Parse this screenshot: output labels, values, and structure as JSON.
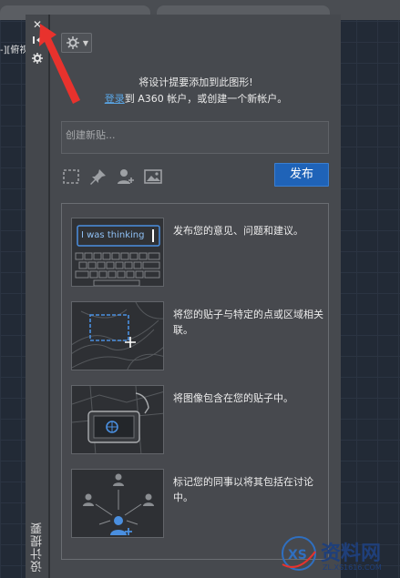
{
  "panel": {
    "title": "设计提要",
    "intro_line1": "将设计提要添加到此图形!",
    "login_link": "登录",
    "intro_line2_rest": "到 A360 帐户，或创建一个新帐户。",
    "post_placeholder": "创建新贴...",
    "publish_label": "发布"
  },
  "canvas": {
    "viewport_label": "-][俯视"
  },
  "features": [
    {
      "desc": "发布您的意见、问题和建议。",
      "thumb_text": "I was thinking"
    },
    {
      "desc": "将您的贴子与特定的点或区域相关联。"
    },
    {
      "desc": "将图像包含在您的贴子中。"
    },
    {
      "desc": "标记您的同事以将其包括在讨论中。"
    }
  ],
  "watermark": {
    "brand": "资料网",
    "url": "ZL.XS1616.COM"
  },
  "colors": {
    "accent": "#1f63b8",
    "link": "#5aa6e6",
    "arrow": "#e8322d"
  }
}
